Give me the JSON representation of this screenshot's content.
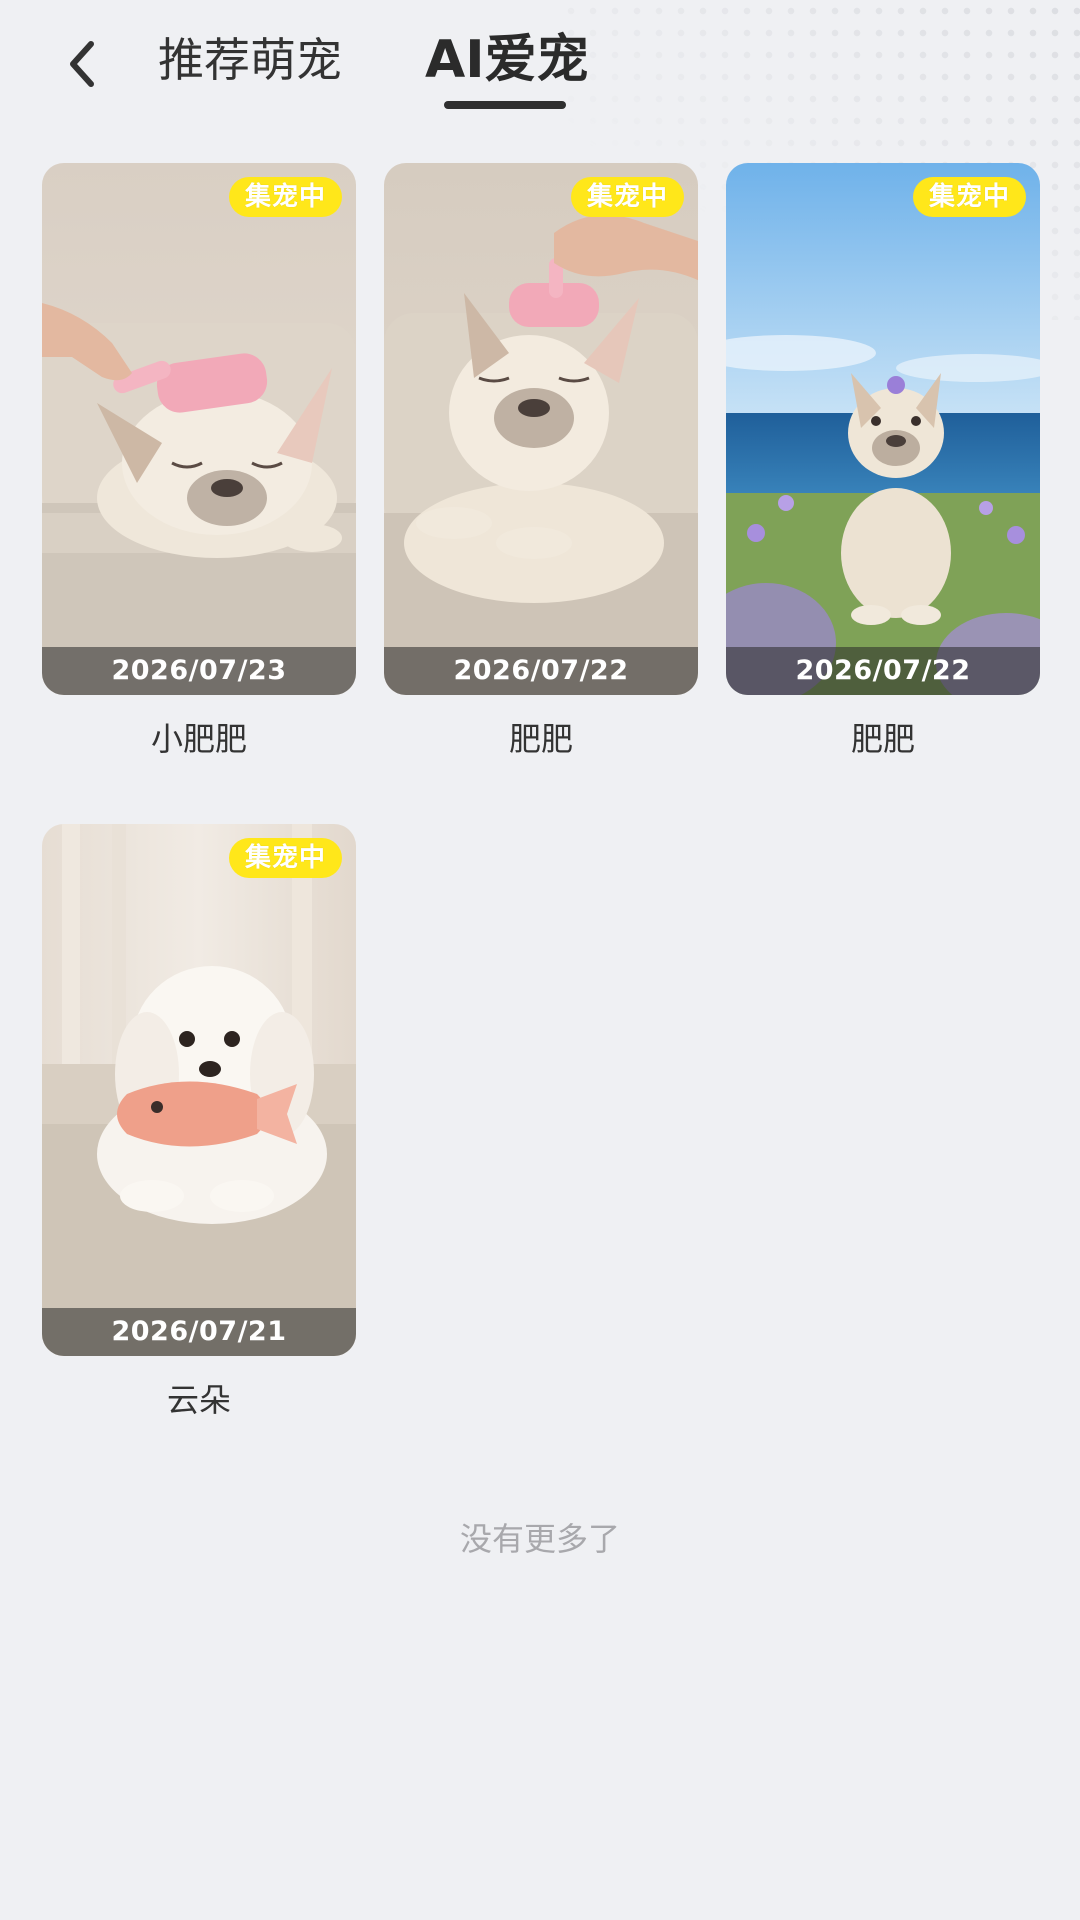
{
  "header": {
    "tabs": [
      {
        "label": "推荐萌宠",
        "active": false
      },
      {
        "label": "AI爱宠",
        "active": true
      }
    ]
  },
  "pets": [
    {
      "badge": "集宠中",
      "date": "2026/07/23",
      "name": "小肥肥",
      "scene": "bulldog-brushed-sofa"
    },
    {
      "badge": "集宠中",
      "date": "2026/07/22",
      "name": "肥肥",
      "scene": "bulldog-brushed-sitting"
    },
    {
      "badge": "集宠中",
      "date": "2026/07/22",
      "name": "肥肥",
      "scene": "bulldog-seaside-flowers"
    },
    {
      "badge": "集宠中",
      "date": "2026/07/21",
      "name": "云朵",
      "scene": "white-dog-fish-toy"
    }
  ],
  "footer": {
    "text": "没有更多了"
  },
  "colors": {
    "badge": "#ffe71a",
    "background": "#eff0f3",
    "text": "#333333",
    "muted": "#a8a8ac"
  }
}
